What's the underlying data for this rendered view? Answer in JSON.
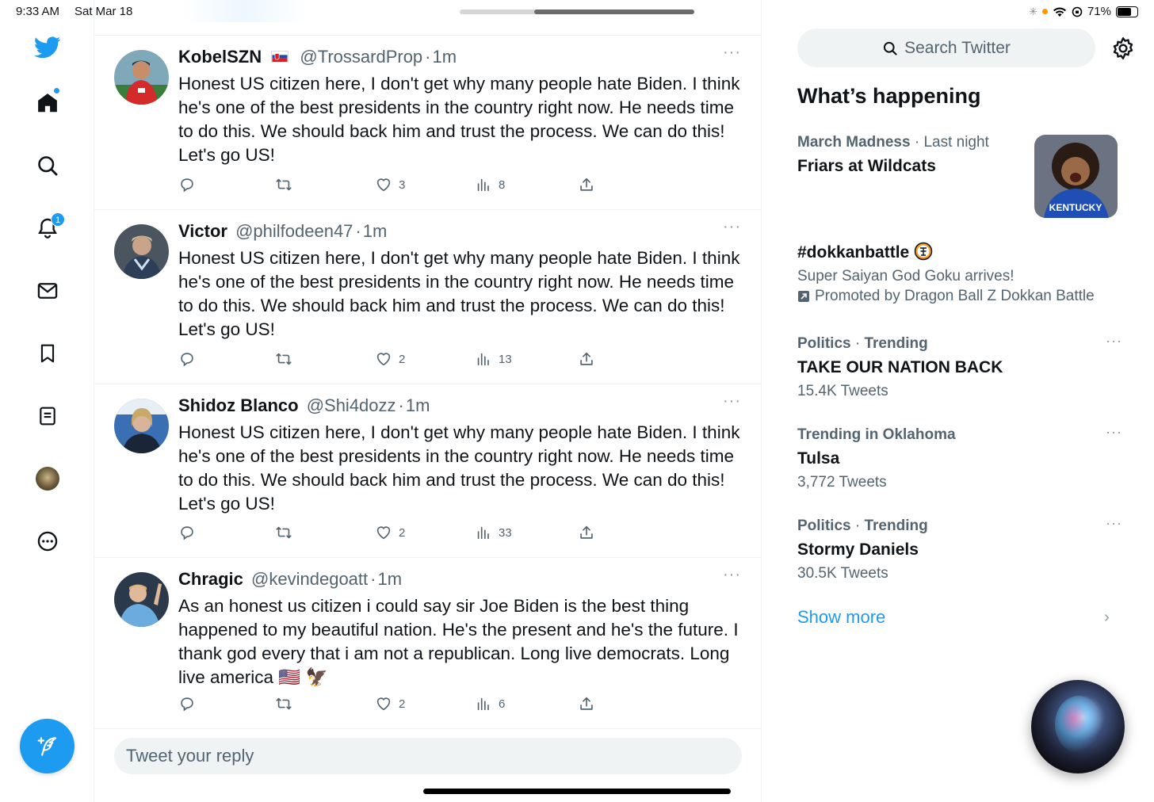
{
  "status": {
    "time": "9:33 AM",
    "date": "Sat Mar 18",
    "battery": "71%",
    "battery_level": 0.71
  },
  "nav": {
    "items": [
      "twitter-logo",
      "home",
      "search",
      "notifications",
      "messages",
      "bookmarks",
      "lists",
      "profile",
      "more"
    ],
    "notifications_badge": "1"
  },
  "tweets": [
    {
      "name": "KobelSZN",
      "flag": "slovakia-flag",
      "handle": "@TrossardProp",
      "time": "1m",
      "text": "Honest US citizen here, I don't get why many people hate Biden. I think he's one of the best presidents  in the country right now. He needs time to do this. We should back him and trust the process. We can do this! Let's go US!",
      "likes": "3",
      "views": "8"
    },
    {
      "name": "Victor",
      "handle": "@philfodeen47",
      "time": "1m",
      "text": "Honest US citizen here, I don't get why many people hate Biden. I think he's one of the best presidents  in the country right now. He needs time to do this. We should back him and trust the process. We can do this! Let's go US!",
      "likes": "2",
      "views": "13"
    },
    {
      "name": "Shidoz Blanco",
      "handle": "@Shi4dozz",
      "time": "1m",
      "text": "Honest US citizen here, I don't get why many people hate Biden. I think he's one of the best presidents  in the country right now. He needs time to do this. We should back him and trust the process. We can do this! Let's go US!",
      "likes": "2",
      "views": "33"
    },
    {
      "name": "Chragic",
      "handle": "@kevindegoatt",
      "time": "1m",
      "text": "As an honest us citizen i could say sir Joe Biden is the best thing happened to my beautiful nation. He's the present and he's the future. I thank god every that i am not a republican. Long live democrats. Long live america 🇺🇸 🦅",
      "likes": "2",
      "views": "6"
    }
  ],
  "reply": {
    "placeholder": "Tweet your reply"
  },
  "sidebar": {
    "search_placeholder": "Search Twitter",
    "whats_happening": "What’s happening",
    "trends": [
      {
        "meta_cat": "March Madness",
        "meta_time": "Last night",
        "title": "Friars at Wildcats"
      },
      {
        "title": "#dokkanbattle",
        "subtitle": "Super Saiyan God Goku arrives!",
        "promoted": "Promoted by Dragon Ball Z Dokkan Battle"
      },
      {
        "meta_cat": "Politics",
        "meta_time": "Trending",
        "title": "TAKE OUR NATION BACK",
        "count": "15.4K Tweets"
      },
      {
        "meta_cat": "Trending in Oklahoma",
        "title": "Tulsa",
        "count": "3,772 Tweets"
      },
      {
        "meta_cat": "Politics",
        "meta_time": "Trending",
        "title": "Stormy Daniels",
        "count": "30.5K Tweets"
      }
    ],
    "show_more": "Show more"
  },
  "colors": {
    "accent": "#1d9bf0",
    "text": "#0f1419",
    "muted": "#536471",
    "border": "#eff3f4"
  }
}
